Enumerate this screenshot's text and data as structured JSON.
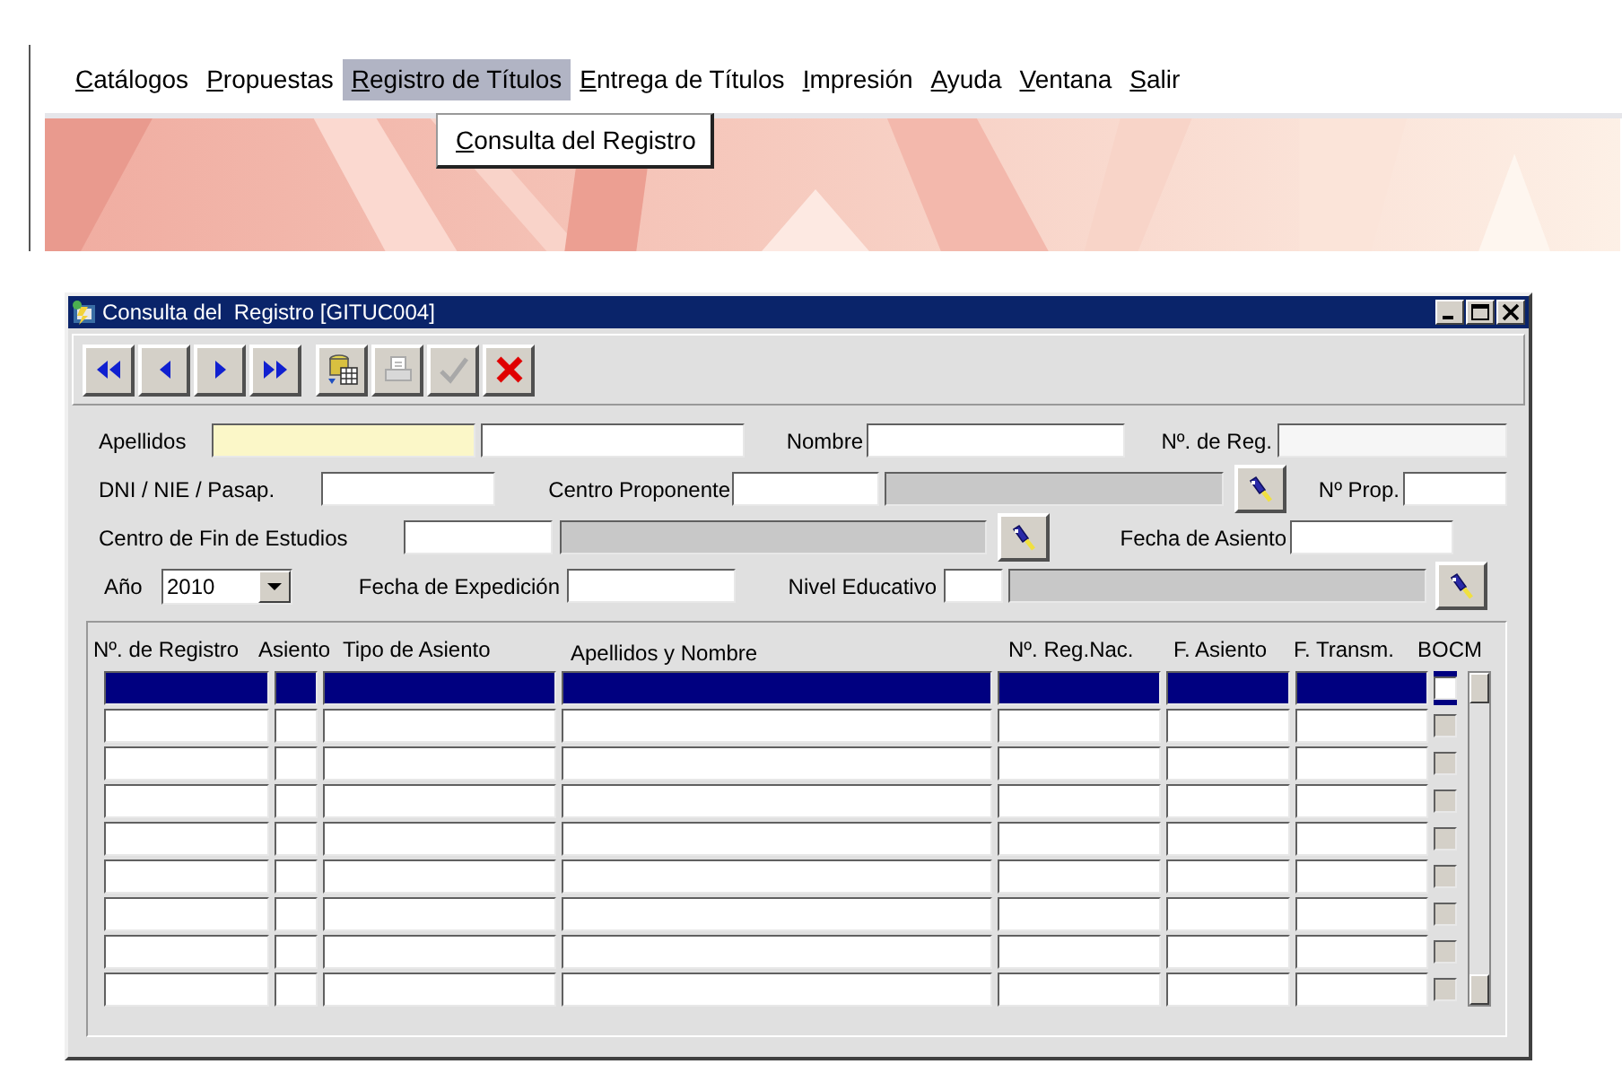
{
  "menu": [
    {
      "label": "Catálogos",
      "selected": false
    },
    {
      "label": "Propuestas",
      "selected": false
    },
    {
      "label": "Registro de Títulos",
      "selected": true
    },
    {
      "label": "Entrega de Títulos",
      "selected": false
    },
    {
      "label": "Impresión",
      "selected": false
    },
    {
      "label": "Ayuda",
      "selected": false
    },
    {
      "label": "Ventana",
      "selected": false
    },
    {
      "label": "Salir",
      "selected": false
    }
  ],
  "dropdown": {
    "items": [
      "Consulta del Registro"
    ]
  },
  "window": {
    "title": "Consulta del  Registro [GITUC004]"
  },
  "toolbar": [
    {
      "kind": "first",
      "disabled": false
    },
    {
      "kind": "previous",
      "disabled": false
    },
    {
      "kind": "next",
      "disabled": false
    },
    {
      "kind": "last",
      "disabled": false
    },
    {
      "kind": "query",
      "disabled": false
    },
    {
      "kind": "print",
      "disabled": true
    },
    {
      "kind": "accept",
      "disabled": true
    },
    {
      "kind": "cancel",
      "disabled": false
    }
  ],
  "form": {
    "lines": [
      {
        "groups": [
          {
            "label": "Apellidos",
            "controls": [
              {
                "kind": "field",
                "highlighted": true
              },
              {
                "kind": "field",
                "highlighted": false
              }
            ]
          },
          {
            "label": "Nombre",
            "controls": [
              {
                "kind": "field",
                "highlighted": false
              }
            ]
          },
          {
            "label": "Nº. de Reg.",
            "controls": [
              {
                "kind": "disabled_field"
              }
            ]
          }
        ]
      },
      {
        "groups": [
          {
            "label": "DNI / NIE / Pasap.",
            "controls": [
              {
                "kind": "field",
                "highlighted": false
              }
            ]
          },
          {
            "label": "Centro Proponente",
            "controls": [
              {
                "kind": "field",
                "highlighted": false
              },
              {
                "kind": "readonly_field"
              },
              {
                "kind": "lov_button"
              }
            ]
          },
          {
            "label": "Nº Prop.",
            "controls": [
              {
                "kind": "field",
                "highlighted": false
              }
            ]
          }
        ]
      },
      {
        "groups": [
          {
            "label": "Centro de Fin de Estudios",
            "controls": [
              {
                "kind": "field",
                "highlighted": false
              },
              {
                "kind": "readonly_field"
              },
              {
                "kind": "lov_button"
              }
            ]
          },
          {
            "label": "Fecha de Asiento",
            "controls": [
              {
                "kind": "field",
                "highlighted": false
              }
            ]
          }
        ]
      },
      {
        "groups": [
          {
            "label": "Año",
            "controls": [
              {
                "kind": "combo",
                "value": "2010"
              }
            ]
          },
          {
            "label": "Fecha de Expedición",
            "controls": [
              {
                "kind": "field",
                "highlighted": false
              }
            ]
          },
          {
            "label": "Nivel Educativo",
            "controls": [
              {
                "kind": "field",
                "highlighted": false
              },
              {
                "kind": "readonly_field"
              },
              {
                "kind": "lov_button"
              }
            ]
          }
        ]
      }
    ]
  },
  "table": {
    "columns": [
      "Nº. de Registro",
      "Asiento",
      "Tipo de Asiento",
      "Apellidos y Nombre",
      "Nº. Reg.Nac.",
      "F. Asiento",
      "F. Transm.",
      "BOCM"
    ],
    "rows": [
      {
        "selected": true,
        "bocm": {
          "checked": false,
          "disabled": false
        }
      },
      {
        "selected": false,
        "bocm": {
          "checked": false,
          "disabled": true
        }
      },
      {
        "selected": false,
        "bocm": {
          "checked": false,
          "disabled": true
        }
      },
      {
        "selected": false,
        "bocm": {
          "checked": false,
          "disabled": true
        }
      },
      {
        "selected": false,
        "bocm": {
          "checked": false,
          "disabled": true
        }
      },
      {
        "selected": false,
        "bocm": {
          "checked": false,
          "disabled": true
        }
      },
      {
        "selected": false,
        "bocm": {
          "checked": false,
          "disabled": true
        }
      },
      {
        "selected": false,
        "bocm": {
          "checked": false,
          "disabled": true
        }
      },
      {
        "selected": false,
        "bocm": {
          "checked": false,
          "disabled": true
        }
      }
    ]
  }
}
